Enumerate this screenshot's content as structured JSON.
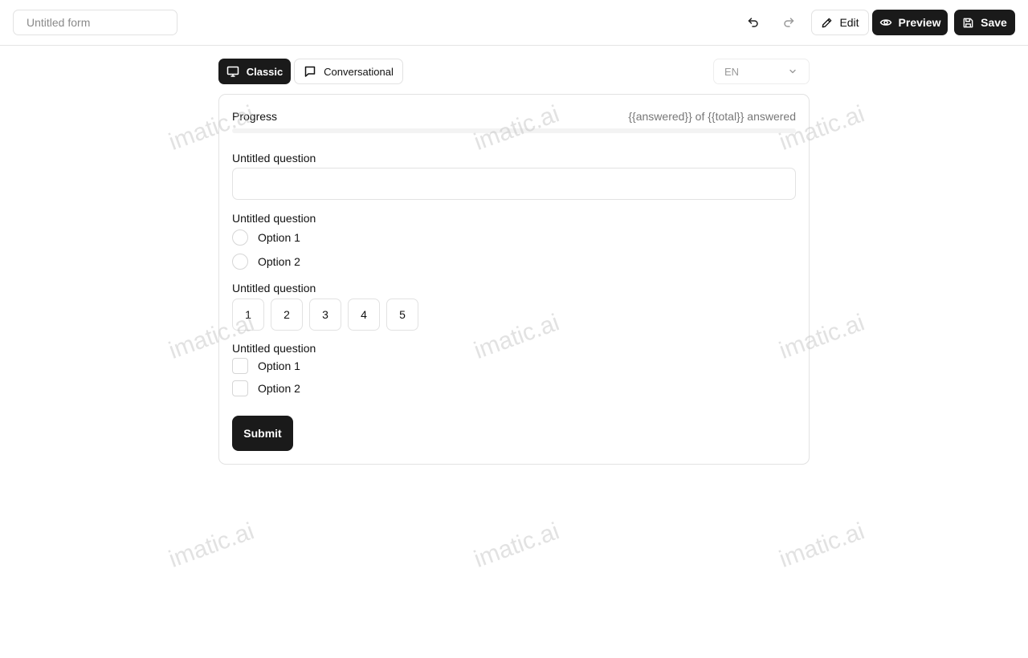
{
  "header": {
    "form_title_placeholder": "Untitled form",
    "undo_icon": "undo-icon",
    "redo_icon": "redo-icon",
    "edit_label": "Edit",
    "preview_label": "Preview",
    "save_label": "Save"
  },
  "mode": {
    "classic_label": "Classic",
    "conversational_label": "Conversational",
    "selected": "Classic"
  },
  "language": {
    "selected": "EN"
  },
  "form": {
    "progress_label": "Progress",
    "progress_count": "{{answered}} of {{total}} answered",
    "progress_fraction": 0,
    "questions": [
      {
        "type": "text",
        "label": "Untitled question",
        "value": ""
      },
      {
        "type": "radio",
        "label": "Untitled question",
        "options": [
          "Option 1",
          "Option 2"
        ]
      },
      {
        "type": "rating",
        "label": "Untitled question",
        "options": [
          "1",
          "2",
          "3",
          "4",
          "5"
        ]
      },
      {
        "type": "checkbox",
        "label": "Untitled question",
        "options": [
          "Option 1",
          "Option 2"
        ]
      }
    ],
    "submit_label": "Submit"
  },
  "watermark": "imatic.ai",
  "colors": {
    "primary": "#1a1a1a",
    "border": "#e2e2e2",
    "muted_text": "#777777"
  }
}
